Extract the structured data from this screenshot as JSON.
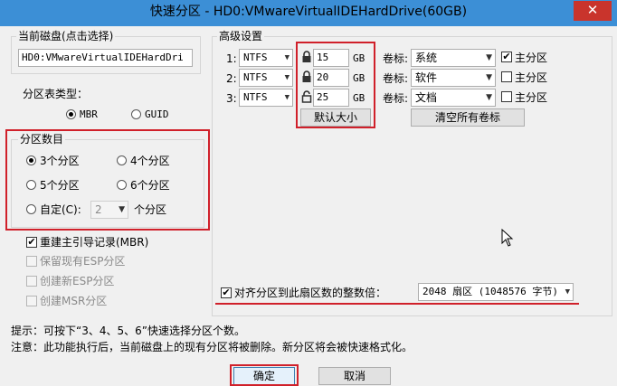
{
  "window": {
    "title": "快速分区 - HD0:VMwareVirtualIDEHardDrive(60GB)",
    "close_glyph": "✕"
  },
  "current_disk": {
    "legend": "当前磁盘(点击选择)",
    "value": "HD0:VMwareVirtualIDEHardDri"
  },
  "partition_table": {
    "label": "分区表类型：",
    "options": [
      "MBR",
      "GUID"
    ],
    "selected": "MBR"
  },
  "partition_count": {
    "legend": "分区数目",
    "options": [
      "3个分区",
      "4个分区",
      "5个分区",
      "6个分区"
    ],
    "selected": "3个分区",
    "custom_label": "自定(C):",
    "custom_value": "2",
    "custom_suffix": "个分区"
  },
  "checkboxes": [
    {
      "label": "重建主引导记录(MBR)",
      "checked": true,
      "enabled": true
    },
    {
      "label": "保留现有ESP分区",
      "checked": false,
      "enabled": false
    },
    {
      "label": "创建新ESP分区",
      "checked": false,
      "enabled": false
    },
    {
      "label": "创建MSR分区",
      "checked": false,
      "enabled": false
    }
  ],
  "advanced": {
    "legend": "高级设置",
    "rows": [
      {
        "index": "1:",
        "fs": "NTFS",
        "size": "15",
        "unit": "GB",
        "label_caption": "卷标:",
        "volume": "系统",
        "primary_label": "主分区",
        "primary": true,
        "lock": "closed"
      },
      {
        "index": "2:",
        "fs": "NTFS",
        "size": "20",
        "unit": "GB",
        "label_caption": "卷标:",
        "volume": "软件",
        "primary_label": "主分区",
        "primary": false,
        "lock": "closed"
      },
      {
        "index": "3:",
        "fs": "NTFS",
        "size": "25",
        "unit": "GB",
        "label_caption": "卷标:",
        "volume": "文档",
        "primary_label": "主分区",
        "primary": false,
        "lock": "open"
      }
    ],
    "default_size_button": "默认大小",
    "clear_labels_button": "清空所有卷标",
    "align_label": "对齐分区到此扇区数的整数倍：",
    "align_checked": true,
    "align_value": "2048 扇区 (1048576 字节)"
  },
  "tips": {
    "line1": "提示：可按下“3、4、5、6”快速选择分区个数。",
    "line2": "注意：此功能执行后，当前磁盘上的现有分区将被删除。新分区将会被快速格式化。"
  },
  "buttons": {
    "ok": "确定",
    "cancel": "取消"
  },
  "colors": {
    "titlebar": "#3c8fd6",
    "highlight_red": "#d0202a",
    "close_red": "#c9342c"
  }
}
